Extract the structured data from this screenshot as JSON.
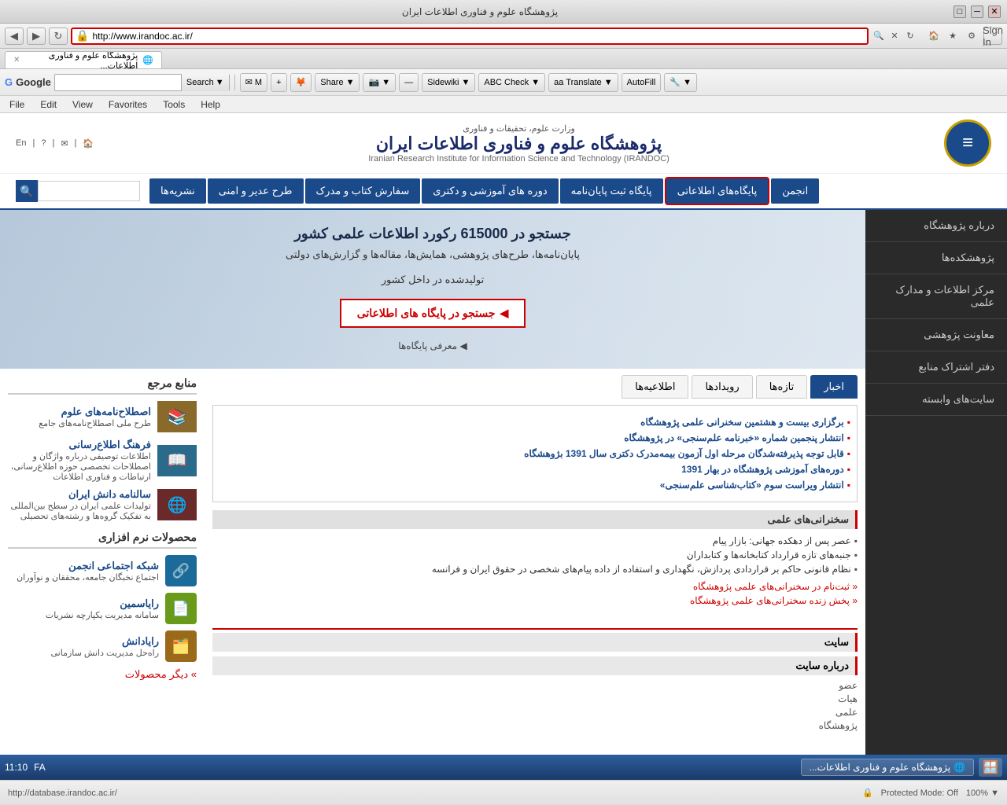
{
  "browser": {
    "title": "پژوهشگاه علوم و فناوری اطلاعات ایران",
    "url": "http://www.irandoc.ac.ir/",
    "tab_label": "پژوهشگاه علوم و فناوری اطلاعات...",
    "status_url": "http://database.irandoc.ac.ir/",
    "time": "11:10",
    "locale": "FA"
  },
  "toolbar": {
    "google_label": "Google",
    "search_placeholder": "Search",
    "search_btn": "Search",
    "back_title": "Back",
    "forward_title": "Forward",
    "refresh_title": "Refresh",
    "home_title": "Home",
    "favorites_title": "Favorites",
    "tools_title": "Tools",
    "share_label": "Share",
    "sidewiki_label": "Sidewiki",
    "check_label": "Check",
    "translate_label": "Translate",
    "autofill_label": "AutoFill",
    "sign_in_label": "Sign In"
  },
  "menu": {
    "items": [
      "File",
      "Edit",
      "View",
      "Favorites",
      "Tools",
      "Help"
    ]
  },
  "site": {
    "logo_symbol": "≡",
    "title": "پژوهشگاه علوم و فناوری اطلاعات ایران",
    "ministry": "وزارت علوم، تحقیقات و فناوری",
    "subtitle": "Iranian Research Institute for Information Science and Technology (IRANDOC)",
    "header_links": [
      "En",
      "|",
      "?",
      "|",
      "✉",
      "|",
      "🏠"
    ],
    "nav_items": [
      {
        "label": "انجمن",
        "active": false
      },
      {
        "label": "پایگاه‌های اطلاعاتی",
        "active": true,
        "highlighted": true
      },
      {
        "label": "پایگاه ثبت پایان‌نامه",
        "active": false
      },
      {
        "label": "دوره های آموزشی و دکتری",
        "active": false
      },
      {
        "label": "سفارش کتاب و مدرک",
        "active": false
      },
      {
        "label": "طرح عدیر و امنی",
        "active": false
      },
      {
        "label": "نشریه‌ها",
        "active": false
      }
    ],
    "sidebar": [
      {
        "label": "درباره پژوهشگاه"
      },
      {
        "label": "پژوهشکده‌ها"
      },
      {
        "label": "مرکز اطلاعات و مدارک علمی"
      },
      {
        "label": "معاونت پژوهشی"
      },
      {
        "label": "دفتر اشتراک منابع"
      },
      {
        "label": "سایت‌های وابسته"
      }
    ],
    "hero": {
      "title": "جستجو در 615000 رکورد اطلاعات علمی کشور",
      "subtitle_line1": "پایان‌نامه‌ها، طرح‌های پژوهشی، همایش‌ها، مقاله‌ها و گزارش‌های دولتی",
      "subtitle_line2": "تولیدشده در داخل کشور",
      "search_btn": "جستجو در پایگاه های اطلاعاتی",
      "link": "معرفی پایگاه‌ها"
    },
    "tabs": [
      "اخبار",
      "تازه‌ها",
      "رویدادها",
      "اطلاعیه‌ها"
    ],
    "active_tab": "اخبار",
    "news": [
      "برگزاری بیست و هشتمین سخنرانی علمی پژوهشگاه",
      "انتشار پنجمین شماره «خبرنامه علم‌سنجی» در پژوهشگاه",
      "قابل توجه پذیرفته‌شدگان مرحله اول آزمون بیمه‌مدرک دکتری سال 1391 بژوهشگاه",
      "دوره‌های آموزشی پژوهشگاه در بهار 1391",
      "انتشار ویراست سوم «کتاب‌شناسی علم‌سنجی»"
    ],
    "lectures_title": "سخنرانی‌های علمی",
    "lectures": [
      "عصر پس از دهکده جهانی: بازار پیام",
      "جنبه‌های تازه قرارداد کتابخانه‌ها و کتابداران",
      "نظام قانونی حاکم بر قراردادی پردازش، نگهداری و استفاده از داده پیام‌های شخصی در حقوق ایران و فرانسه"
    ],
    "lecture_links": [
      "ثبت‌نام در سخنرانی‌های علمی پژوهشگاه",
      "پخش زنده سخنرانی‌های علمی پژوهشگاه"
    ],
    "site_section_title": "سایت",
    "site_about": "درباره سایت",
    "site_links": [
      "عضو",
      "هیات",
      "علمی",
      "پژوهشگاه"
    ],
    "resources": {
      "title": "منابع مرجع",
      "items": [
        {
          "title": "اصطلاح‌نامه‌های علوم",
          "desc": "طرح ملی اصطلاح‌نامه‌های جامع"
        },
        {
          "title": "فرهنگ اطلاع‌رسانی",
          "desc": "اطلاعات توصیفی درباره واژگان و اصطلاحات تخصصی حوزه اطلاع‌رسانی، ارتباطات و فناوری اطلاعات"
        },
        {
          "title": "سالنامه دانش ایران",
          "desc": "تولیدات علمی ایران در سطح بین‌المللی به تفکیک گروه‌ها و رشته‌های تحصیلی"
        }
      ]
    },
    "products": {
      "title": "محصولات نرم افزاری",
      "items": [
        {
          "title": "شبکه اجتماعی انجمن",
          "desc": "اجتماع نخبگان جامعه، محققان و نوآوران",
          "color": "#1a6a9a"
        },
        {
          "title": "رایاسمین",
          "desc": "سامانه مدیریت یکپارچه نشریات",
          "color": "#6a9a1a"
        },
        {
          "title": "رایادانش",
          "desc": "راه‌حل مدیریت دانش سازمانی",
          "color": "#9a6a1a"
        }
      ],
      "more_label": "» دیگر محصولات"
    }
  }
}
